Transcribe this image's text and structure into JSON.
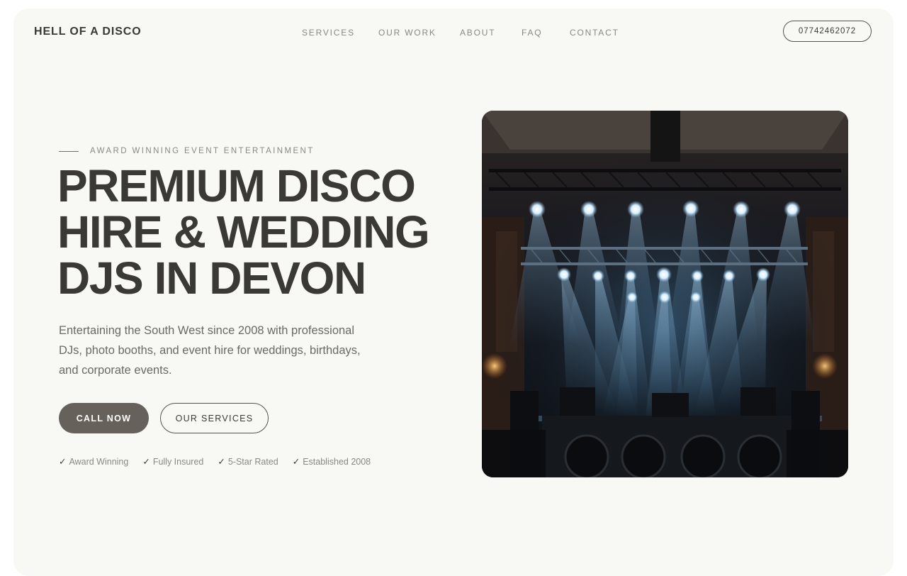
{
  "header": {
    "brand": "HELL OF A DISCO",
    "nav": [
      "SERVICES",
      "OUR WORK",
      "ABOUT",
      "FAQ",
      "CONTACT"
    ],
    "phone": "07742462072"
  },
  "hero": {
    "eyebrow": "AWARD WINNING EVENT ENTERTAINMENT",
    "headline_lines": [
      "PREMIUM DISCO",
      "HIRE & WEDDING",
      "DJS IN DEVON"
    ],
    "description": "Entertaining the South West since 2008 with professional DJs, photo booths, and event hire for weddings, birthdays, and corporate events.",
    "primary_cta": "CALL NOW",
    "secondary_cta": "OUR SERVICES",
    "badges": [
      "Award Winning",
      "Fully Insured",
      "5-Star Rated",
      "Established 2008"
    ],
    "check_glyph": "✓",
    "image_icon": "stage-lights-image"
  },
  "colors": {
    "page_bg": "#f8f8f5",
    "text_dark": "#3a3935",
    "text_muted": "#8a8883",
    "button_fill": "#66625b"
  }
}
